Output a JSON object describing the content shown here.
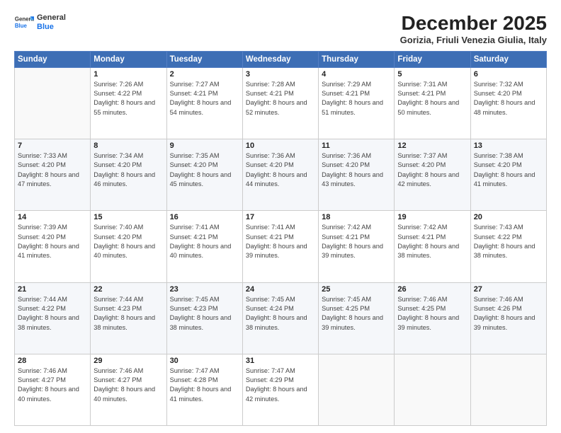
{
  "header": {
    "logo_general": "General",
    "logo_blue": "Blue",
    "month_title": "December 2025",
    "location": "Gorizia, Friuli Venezia Giulia, Italy"
  },
  "days_of_week": [
    "Sunday",
    "Monday",
    "Tuesday",
    "Wednesday",
    "Thursday",
    "Friday",
    "Saturday"
  ],
  "weeks": [
    [
      {
        "day": "",
        "sunrise": "",
        "sunset": "",
        "daylight": ""
      },
      {
        "day": "1",
        "sunrise": "Sunrise: 7:26 AM",
        "sunset": "Sunset: 4:22 PM",
        "daylight": "Daylight: 8 hours and 55 minutes."
      },
      {
        "day": "2",
        "sunrise": "Sunrise: 7:27 AM",
        "sunset": "Sunset: 4:21 PM",
        "daylight": "Daylight: 8 hours and 54 minutes."
      },
      {
        "day": "3",
        "sunrise": "Sunrise: 7:28 AM",
        "sunset": "Sunset: 4:21 PM",
        "daylight": "Daylight: 8 hours and 52 minutes."
      },
      {
        "day": "4",
        "sunrise": "Sunrise: 7:29 AM",
        "sunset": "Sunset: 4:21 PM",
        "daylight": "Daylight: 8 hours and 51 minutes."
      },
      {
        "day": "5",
        "sunrise": "Sunrise: 7:31 AM",
        "sunset": "Sunset: 4:21 PM",
        "daylight": "Daylight: 8 hours and 50 minutes."
      },
      {
        "day": "6",
        "sunrise": "Sunrise: 7:32 AM",
        "sunset": "Sunset: 4:20 PM",
        "daylight": "Daylight: 8 hours and 48 minutes."
      }
    ],
    [
      {
        "day": "7",
        "sunrise": "Sunrise: 7:33 AM",
        "sunset": "Sunset: 4:20 PM",
        "daylight": "Daylight: 8 hours and 47 minutes."
      },
      {
        "day": "8",
        "sunrise": "Sunrise: 7:34 AM",
        "sunset": "Sunset: 4:20 PM",
        "daylight": "Daylight: 8 hours and 46 minutes."
      },
      {
        "day": "9",
        "sunrise": "Sunrise: 7:35 AM",
        "sunset": "Sunset: 4:20 PM",
        "daylight": "Daylight: 8 hours and 45 minutes."
      },
      {
        "day": "10",
        "sunrise": "Sunrise: 7:36 AM",
        "sunset": "Sunset: 4:20 PM",
        "daylight": "Daylight: 8 hours and 44 minutes."
      },
      {
        "day": "11",
        "sunrise": "Sunrise: 7:36 AM",
        "sunset": "Sunset: 4:20 PM",
        "daylight": "Daylight: 8 hours and 43 minutes."
      },
      {
        "day": "12",
        "sunrise": "Sunrise: 7:37 AM",
        "sunset": "Sunset: 4:20 PM",
        "daylight": "Daylight: 8 hours and 42 minutes."
      },
      {
        "day": "13",
        "sunrise": "Sunrise: 7:38 AM",
        "sunset": "Sunset: 4:20 PM",
        "daylight": "Daylight: 8 hours and 41 minutes."
      }
    ],
    [
      {
        "day": "14",
        "sunrise": "Sunrise: 7:39 AM",
        "sunset": "Sunset: 4:20 PM",
        "daylight": "Daylight: 8 hours and 41 minutes."
      },
      {
        "day": "15",
        "sunrise": "Sunrise: 7:40 AM",
        "sunset": "Sunset: 4:20 PM",
        "daylight": "Daylight: 8 hours and 40 minutes."
      },
      {
        "day": "16",
        "sunrise": "Sunrise: 7:41 AM",
        "sunset": "Sunset: 4:21 PM",
        "daylight": "Daylight: 8 hours and 40 minutes."
      },
      {
        "day": "17",
        "sunrise": "Sunrise: 7:41 AM",
        "sunset": "Sunset: 4:21 PM",
        "daylight": "Daylight: 8 hours and 39 minutes."
      },
      {
        "day": "18",
        "sunrise": "Sunrise: 7:42 AM",
        "sunset": "Sunset: 4:21 PM",
        "daylight": "Daylight: 8 hours and 39 minutes."
      },
      {
        "day": "19",
        "sunrise": "Sunrise: 7:42 AM",
        "sunset": "Sunset: 4:21 PM",
        "daylight": "Daylight: 8 hours and 38 minutes."
      },
      {
        "day": "20",
        "sunrise": "Sunrise: 7:43 AM",
        "sunset": "Sunset: 4:22 PM",
        "daylight": "Daylight: 8 hours and 38 minutes."
      }
    ],
    [
      {
        "day": "21",
        "sunrise": "Sunrise: 7:44 AM",
        "sunset": "Sunset: 4:22 PM",
        "daylight": "Daylight: 8 hours and 38 minutes."
      },
      {
        "day": "22",
        "sunrise": "Sunrise: 7:44 AM",
        "sunset": "Sunset: 4:23 PM",
        "daylight": "Daylight: 8 hours and 38 minutes."
      },
      {
        "day": "23",
        "sunrise": "Sunrise: 7:45 AM",
        "sunset": "Sunset: 4:23 PM",
        "daylight": "Daylight: 8 hours and 38 minutes."
      },
      {
        "day": "24",
        "sunrise": "Sunrise: 7:45 AM",
        "sunset": "Sunset: 4:24 PM",
        "daylight": "Daylight: 8 hours and 38 minutes."
      },
      {
        "day": "25",
        "sunrise": "Sunrise: 7:45 AM",
        "sunset": "Sunset: 4:25 PM",
        "daylight": "Daylight: 8 hours and 39 minutes."
      },
      {
        "day": "26",
        "sunrise": "Sunrise: 7:46 AM",
        "sunset": "Sunset: 4:25 PM",
        "daylight": "Daylight: 8 hours and 39 minutes."
      },
      {
        "day": "27",
        "sunrise": "Sunrise: 7:46 AM",
        "sunset": "Sunset: 4:26 PM",
        "daylight": "Daylight: 8 hours and 39 minutes."
      }
    ],
    [
      {
        "day": "28",
        "sunrise": "Sunrise: 7:46 AM",
        "sunset": "Sunset: 4:27 PM",
        "daylight": "Daylight: 8 hours and 40 minutes."
      },
      {
        "day": "29",
        "sunrise": "Sunrise: 7:46 AM",
        "sunset": "Sunset: 4:27 PM",
        "daylight": "Daylight: 8 hours and 40 minutes."
      },
      {
        "day": "30",
        "sunrise": "Sunrise: 7:47 AM",
        "sunset": "Sunset: 4:28 PM",
        "daylight": "Daylight: 8 hours and 41 minutes."
      },
      {
        "day": "31",
        "sunrise": "Sunrise: 7:47 AM",
        "sunset": "Sunset: 4:29 PM",
        "daylight": "Daylight: 8 hours and 42 minutes."
      },
      {
        "day": "",
        "sunrise": "",
        "sunset": "",
        "daylight": ""
      },
      {
        "day": "",
        "sunrise": "",
        "sunset": "",
        "daylight": ""
      },
      {
        "day": "",
        "sunrise": "",
        "sunset": "",
        "daylight": ""
      }
    ]
  ]
}
